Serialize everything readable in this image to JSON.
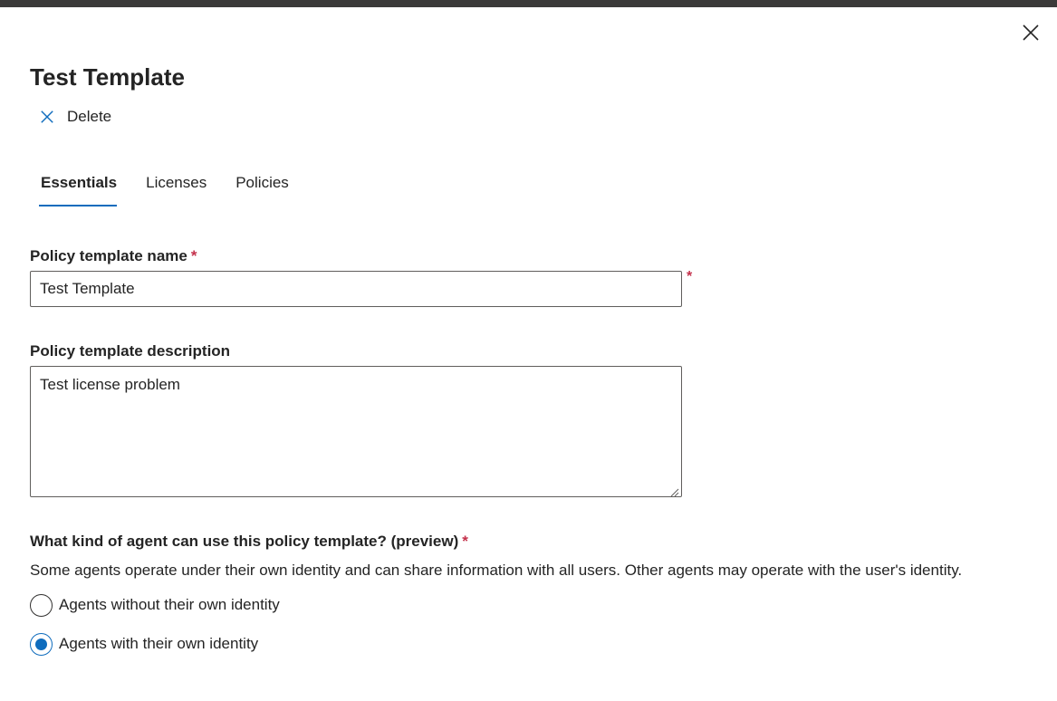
{
  "panel": {
    "title": "Test Template",
    "delete_label": "Delete"
  },
  "tabs": [
    {
      "label": "Essentials",
      "active": true
    },
    {
      "label": "Licenses",
      "active": false
    },
    {
      "label": "Policies",
      "active": false
    }
  ],
  "form": {
    "name": {
      "label": "Policy template name",
      "required_mark": "*",
      "value": "Test Template"
    },
    "description": {
      "label": "Policy template description",
      "value": "Test license problem"
    },
    "agent_kind": {
      "label": "What kind of agent can use this policy template? (preview)",
      "required_mark": "*",
      "helper": "Some agents operate under their own identity and can share information with all users. Other agents may operate with the user's identity.",
      "options": [
        {
          "label": "Agents without their own identity",
          "checked": false
        },
        {
          "label": "Agents with their own identity",
          "checked": true
        }
      ]
    }
  },
  "colors": {
    "accent": "#0f6cbd",
    "required": "#c4314b",
    "top_bar": "#3b3a39"
  },
  "icons": {
    "close": "close-icon",
    "delete": "delete-x-icon"
  }
}
